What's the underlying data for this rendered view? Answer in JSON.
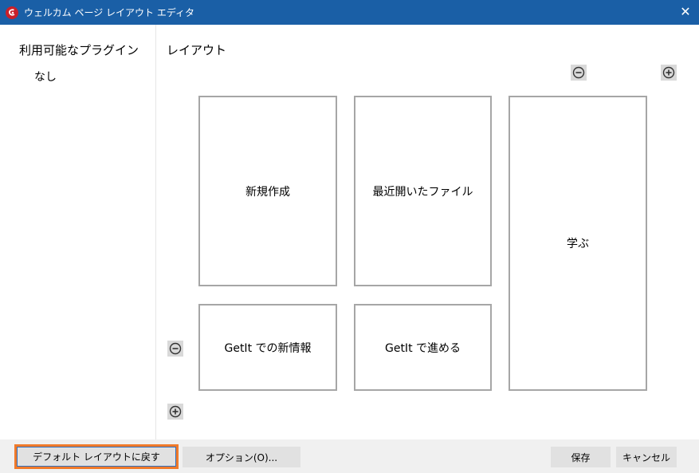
{
  "window": {
    "title": "ウェルカム ページ レイアウト エディタ",
    "close_glyph": "✕"
  },
  "plugins": {
    "heading": "利用可能なプラグイン",
    "empty_text": "なし"
  },
  "layout": {
    "heading": "レイアウト",
    "tiles": [
      {
        "label": "新規作成"
      },
      {
        "label": "最近開いたファイル"
      },
      {
        "label": "学ぶ"
      },
      {
        "label": "GetIt での新情報"
      },
      {
        "label": "GetIt で進める"
      }
    ]
  },
  "buttons": {
    "reset": "デフォルト レイアウトに戻す",
    "options": "オプション(O)...",
    "save": "保存",
    "cancel": "キャンセル"
  },
  "colors": {
    "titlebar": "#1a5fa6",
    "focus_outline": "#f07a2a",
    "tile_border": "#a6a6a6",
    "button_face": "#e1e1e1"
  }
}
